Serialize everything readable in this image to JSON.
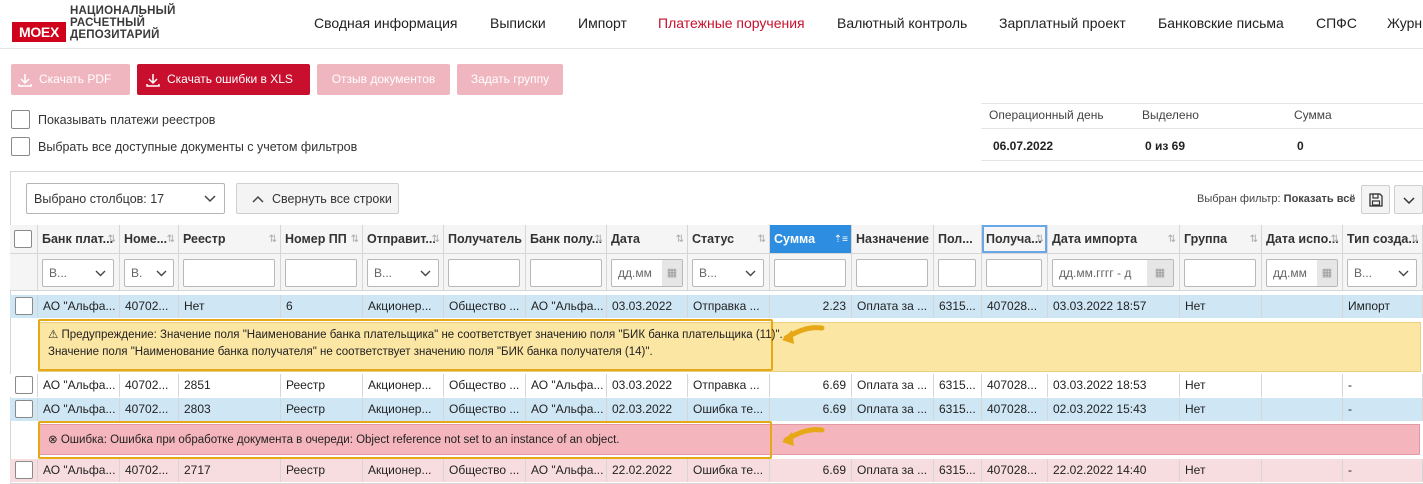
{
  "header": {
    "logo_moex": "MOEX",
    "logo_lines": [
      "НАЦИОНАЛЬНЫЙ",
      "РАСЧЕТНЫЙ",
      "ДЕПОЗИТАРИЙ"
    ],
    "nav": [
      {
        "label": "Сводная информация",
        "active": false
      },
      {
        "label": "Выписки",
        "active": false
      },
      {
        "label": "Импорт",
        "active": false
      },
      {
        "label": "Платежные поручения",
        "active": true
      },
      {
        "label": "Валютный контроль",
        "active": false
      },
      {
        "label": "Зарплатный проект",
        "active": false
      },
      {
        "label": "Банковские письма",
        "active": false
      },
      {
        "label": "СПФС",
        "active": false
      },
      {
        "label": "Журн",
        "active": false
      }
    ]
  },
  "toolbar": {
    "download_pdf": "Скачать PDF",
    "download_errors": "Скачать ошибки в XLS",
    "recall": "Отзыв документов",
    "set_group": "Задать группу"
  },
  "options": {
    "show_registry": "Показывать платежи реестров",
    "select_all": "Выбрать все доступные документы с учетом фильтров"
  },
  "stats": {
    "op_day_label": "Операционный день",
    "op_day_value": "06.07.2022",
    "selected_label": "Выделено",
    "selected_value": "0 из 69",
    "sum_label": "Сумма",
    "sum_value": "0"
  },
  "grid_toolbar": {
    "columns_select": "Выбрано столбцов: 17",
    "collapse": "Свернуть все строки",
    "filter_label": "Выбран фильтр:",
    "filter_value": "Показать всё"
  },
  "columns": [
    "Банк плат...",
    "Номе...",
    "Реестр",
    "Номер ПП",
    "Отправит...",
    "Получатель",
    "Банк полу...",
    "Дата",
    "Статус",
    "Сумма",
    "Назначение",
    "Пол...",
    "Получа...",
    "Дата импорта",
    "Группа",
    "Дата испо...",
    "Тип созда..."
  ],
  "filters": {
    "select_short": "В...",
    "select_short2": "В.",
    "date_placeholder": "дд.мм",
    "date_range_placeholder": "дд.мм.гггг - д"
  },
  "rows": [
    {
      "cells": [
        "АО \"Альфа...",
        "40702...",
        "Нет",
        "6",
        "Акционер...",
        "Общество ...",
        "АО \"Альфа...",
        "03.03.2022",
        "Отправка ...",
        "2.23",
        "Оплата за ...",
        "6315...",
        "407028...",
        "03.03.2022 18:57",
        "Нет",
        "",
        "Импорт"
      ]
    },
    {
      "cells": [
        "АО \"Альфа...",
        "40702...",
        "2851",
        "Реестр",
        "Акционер...",
        "Общество ...",
        "АО \"Альфа...",
        "03.03.2022",
        "Отправка ...",
        "6.69",
        "Оплата за ...",
        "6315...",
        "407028...",
        "03.03.2022 18:53",
        "Нет",
        "",
        "-"
      ]
    },
    {
      "cells": [
        "АО \"Альфа...",
        "40702...",
        "2803",
        "Реестр",
        "Акционер...",
        "Общество ...",
        "АО \"Альфа...",
        "02.03.2022",
        "Ошибка те...",
        "6.69",
        "Оплата за ...",
        "6315...",
        "407028...",
        "02.03.2022 15:43",
        "Нет",
        "",
        "-"
      ]
    },
    {
      "cells": [
        "АО \"Альфа...",
        "40702...",
        "2717",
        "Реестр",
        "Акционер...",
        "Общество ...",
        "АО \"Альфа...",
        "22.02.2022",
        "Ошибка те...",
        "6.69",
        "Оплата за ...",
        "6315...",
        "407028...",
        "22.02.2022 14:40",
        "Нет",
        "",
        "-"
      ]
    }
  ],
  "warning": {
    "line1": "Предупреждение: Значение поля \"Наименование банка плательщика\" не соответствует значению поля \"БИК банка плательщика (11)\".",
    "line2": "Значение поля \"Наименование банка получателя\" не соответствует значению поля \"БИК банка получателя (14)\"."
  },
  "error": {
    "text": "Ошибка: Ошибка при обработке документа в очереди: Object reference not set to an instance of an object."
  },
  "colors": {
    "accent": "#c8102e",
    "sorted_header": "#2d8de0",
    "warning_bg": "#fce6a4",
    "error_bg": "#f4b5bd",
    "highlight": "#e6a817"
  }
}
